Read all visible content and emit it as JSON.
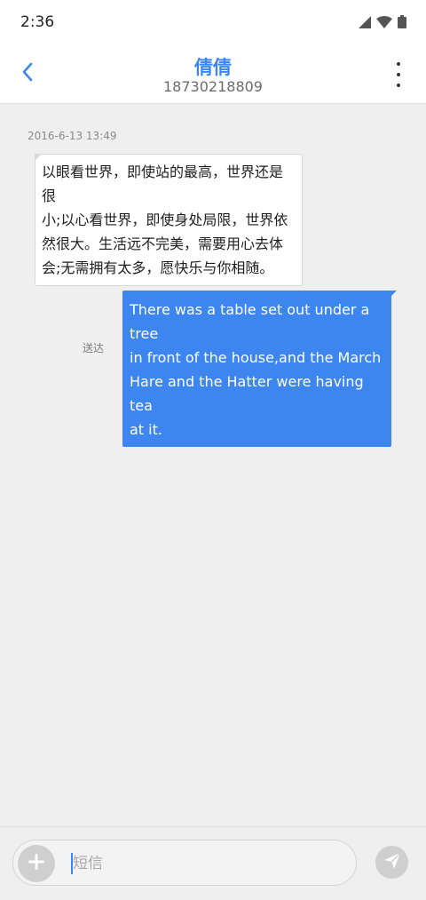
{
  "status_bar": {
    "time": "2:36",
    "icons": [
      "cellular-signal-icon",
      "wifi-icon",
      "battery-icon"
    ]
  },
  "header": {
    "contact_name": "倩倩",
    "contact_number": "18730218809",
    "back_icon": "chevron-left-icon",
    "menu_icon": "more-vertical-icon"
  },
  "conversation": {
    "timestamp": "2016-6-13 13:49",
    "messages": [
      {
        "direction": "incoming",
        "lines": [
          "以眼看世界，即使站的最高，世界还是很",
          "小;以心看世界，即使身处局限，世界依",
          "然很大。生活远不完美，需要用心去体",
          "会;无需拥有太多，愿快乐与你相随。"
        ]
      },
      {
        "direction": "outgoing",
        "lines": [
          "There was a table set out under a tree",
          "in front of the house,and the March",
          "Hare and the Hatter were having tea",
          "at it."
        ],
        "status": "送达"
      }
    ]
  },
  "composer": {
    "placeholder": "短信",
    "value": "",
    "add_icon": "plus-icon",
    "send_icon": "send-icon"
  },
  "colors": {
    "accent": "#3d86f0",
    "background": "#efefef",
    "incoming_bubble": "#ffffff",
    "outgoing_bubble": "#3d86f0"
  }
}
